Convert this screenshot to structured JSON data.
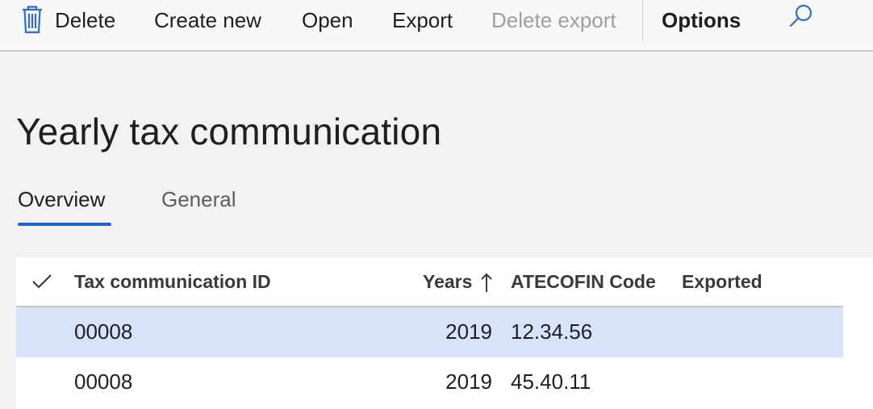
{
  "toolbar": {
    "delete_label": "Delete",
    "create_new_label": "Create new",
    "open_label": "Open",
    "export_label": "Export",
    "delete_export_label": "Delete export",
    "options_label": "Options",
    "icons": {
      "delete": "trash-icon",
      "search": "search-icon"
    },
    "accent_color": "#2e6bd6"
  },
  "page": {
    "title": "Yearly tax communication"
  },
  "tabs": [
    {
      "label": "Overview",
      "active": true
    },
    {
      "label": "General",
      "active": false
    }
  ],
  "grid": {
    "columns": [
      "Tax communication ID",
      "Years",
      "ATECOFIN Code",
      "Exported"
    ],
    "sort": {
      "column": "Years",
      "direction": "ascending"
    },
    "rows": [
      {
        "id": "00008",
        "years": "2019",
        "atecofin": "12.34.56",
        "exported": "",
        "selected": true
      },
      {
        "id": "00008",
        "years": "2019",
        "atecofin": "45.40.11",
        "exported": "",
        "selected": false
      }
    ],
    "selected_row_color": "#d7e3f9"
  }
}
